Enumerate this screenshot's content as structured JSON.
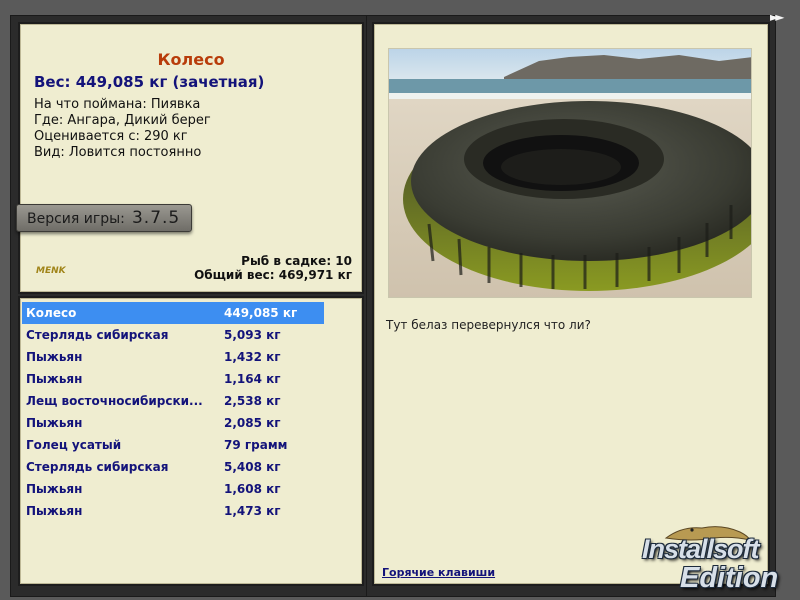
{
  "info": {
    "title": "Колесо",
    "weight_line": "Вес: 449,085 кг (зачетная)",
    "lines": [
      "На что поймана: Пиявка",
      "Где: Ангара, Дикий берег",
      "Оценивается с: 290 кг",
      "Вид: Ловится постоянно"
    ],
    "version_label": "Версия игры:",
    "version_number": "3.7.5",
    "mini_logo": "MENK",
    "fish_in_keepnet": "Рыб в садке: 10",
    "total_weight": "Общий вес: 469,971 кг"
  },
  "catch_list": [
    {
      "name": "Колесо",
      "weight": "449,085 кг",
      "selected": true
    },
    {
      "name": "Стерлядь сибирская",
      "weight": "5,093 кг"
    },
    {
      "name": "Пыжьян",
      "weight": "1,432 кг"
    },
    {
      "name": "Пыжьян",
      "weight": "1,164 кг"
    },
    {
      "name": "Лещ восточносибирски...",
      "weight": "2,538 кг"
    },
    {
      "name": "Пыжьян",
      "weight": "2,085 кг"
    },
    {
      "name": "Голец усатый",
      "weight": "79 грамм"
    },
    {
      "name": "Стерлядь сибирская",
      "weight": "5,408 кг"
    },
    {
      "name": "Пыжьян",
      "weight": "1,608 кг"
    },
    {
      "name": "Пыжьян",
      "weight": "1,473 кг"
    }
  ],
  "description": {
    "comment": "Тут белаз перевернулся что ли?",
    "hotkeys_link": "Горячие клавиши",
    "photo_subject": "tire-on-beach"
  },
  "nav": {
    "forward_icon": "fast-forward-icon",
    "forward_glyph": "►►"
  },
  "watermark": {
    "line1": "Installsoft",
    "line2": "Edition"
  },
  "colors": {
    "panel_bg": "#efedd0",
    "title": "#b83c0a",
    "text_blue": "#13137a",
    "selection": "#3d8ef1"
  }
}
